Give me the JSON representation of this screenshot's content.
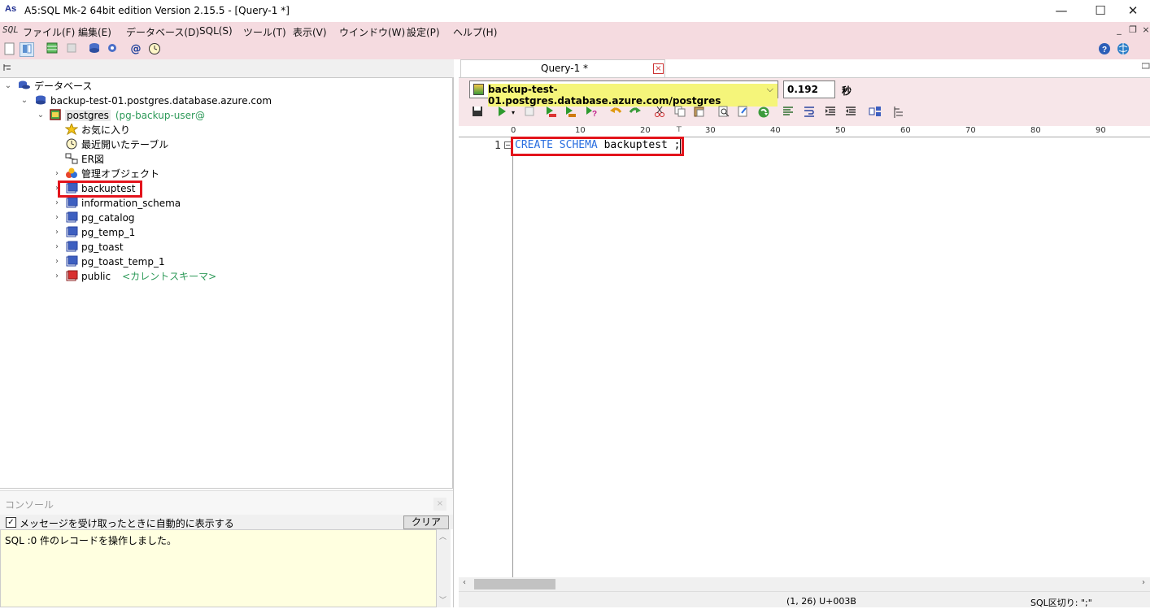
{
  "window": {
    "title": "A5:SQL Mk-2 64bit edition Version 2.15.5 - [Query-1 *]",
    "app_icon_text": "As",
    "minimize": "—",
    "maximize": "☐",
    "close": "✕"
  },
  "menu": {
    "sql_icon": "SQL",
    "items": [
      "ファイル(F)",
      "編集(E)",
      "データベース(D)",
      "SQL(S)",
      "ツール(T)",
      "表示(V)",
      "ウインドウ(W)",
      "設定(P)",
      "ヘルプ(H)"
    ],
    "mdi_min": "_",
    "mdi_restore": "❐",
    "mdi_close": "×"
  },
  "tree": {
    "root": "データベース",
    "server": "backup-test-01.postgres.database.azure.com",
    "db": "postgres",
    "db_user": "(pg-backup-user@",
    "favorites": "お気に入り",
    "recent": "最近開いたテーブル",
    "er": "ER図",
    "admin": "管理オブジェクト",
    "schemas": [
      "backuptest",
      "information_schema",
      "pg_catalog",
      "pg_temp_1",
      "pg_toast",
      "pg_toast_temp_1",
      "public"
    ],
    "current_schema_note": "<カレントスキーマ>"
  },
  "console": {
    "title": "コンソール",
    "close": "×",
    "autoshow_label": "メッセージを受け取ったときに自動的に表示する",
    "autoshow_checked": "✓",
    "clear_label": "クリア",
    "log": "SQL  :0 件のレコードを操作しました。"
  },
  "query": {
    "tab_label": "Query-1 *",
    "tab_close": "×",
    "connection": "backup-test-01.postgres.database.azure.com/postgres",
    "dropdown_arrow": "⌵",
    "elapsed": "0.192",
    "elapsed_unit": "秒",
    "ruler_labels": [
      "0",
      "10",
      "20",
      "30",
      "40",
      "50",
      "60",
      "70",
      "80",
      "90"
    ],
    "line_number": "1",
    "fold_marker": "−",
    "code_keyword": "CREATE SCHEMA",
    "code_rest": " backuptest ;"
  },
  "status": {
    "position": "(1, 26) U+003B",
    "separator": "SQL区切り: \";\""
  },
  "colors": {
    "menu_bg": "#f5dbe0",
    "highlight_box": "#e3141c",
    "keyword": "#2a6fe0",
    "schema_note": "#2e9a59"
  }
}
